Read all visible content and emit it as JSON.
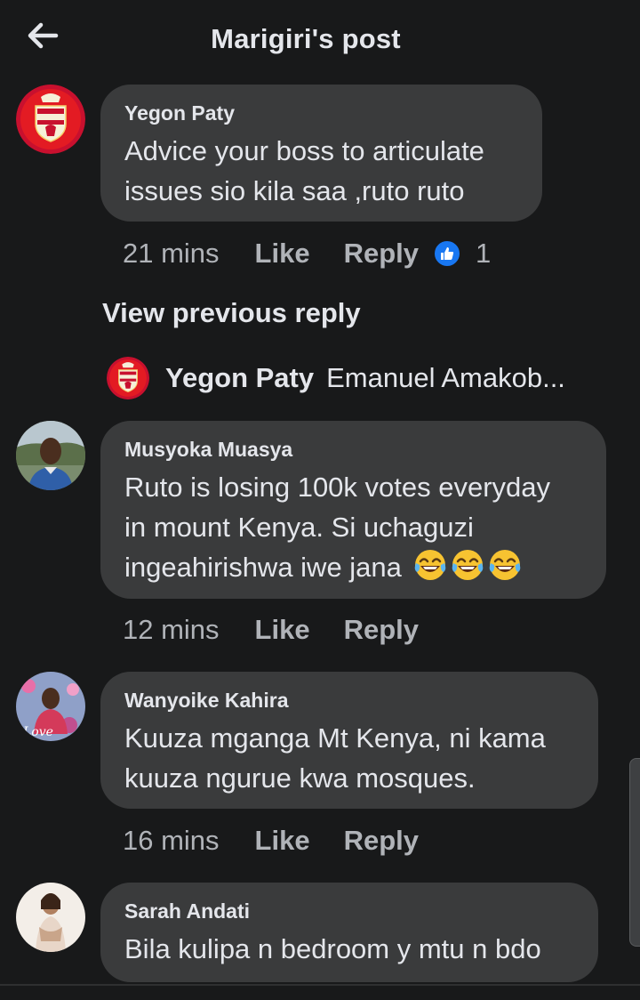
{
  "header": {
    "title": "Marigiri's post",
    "back_icon": "arrow-left-icon"
  },
  "comments": [
    {
      "author": "Yegon Paty",
      "text_lines": [
        "Advice your boss to articulate",
        "issues sio kila saa ,ruto ruto"
      ],
      "time": "21 mins",
      "like_label": "Like",
      "reply_label": "Reply",
      "reaction_count": "1",
      "avatar": "liverpool-crest"
    },
    {
      "author": "Musyoka Muasya",
      "text_lines": [
        "Ruto is losing 100k votes everyday",
        "in mount Kenya. Si uchaguzi",
        "ingeahirishwa iwe jana"
      ],
      "emojis": [
        "😂",
        "😂",
        "😂"
      ],
      "time": "12 mins",
      "like_label": "Like",
      "reply_label": "Reply",
      "avatar": "man-photo"
    },
    {
      "author": "Wanyoike Kahira",
      "text_lines": [
        "Kuuza mganga Mt Kenya, ni kama",
        "kuuza ngurue kwa mosques."
      ],
      "time": "16 mins",
      "like_label": "Like",
      "reply_label": "Reply",
      "avatar": "love-photo"
    },
    {
      "author": "Sarah Andati",
      "text_lines": [
        "Bila kulipa n bedroom y mtu n bdo"
      ],
      "avatar": "woman-photo"
    }
  ],
  "view_previous_reply": "View previous reply",
  "reply_preview": {
    "author": "Yegon Paty",
    "text": "Emanuel Amakob..."
  },
  "colors": {
    "background": "#18191a",
    "bubble": "#3a3b3c",
    "secondary_text": "#b0b3b8",
    "like_blue": "#1877f2"
  }
}
